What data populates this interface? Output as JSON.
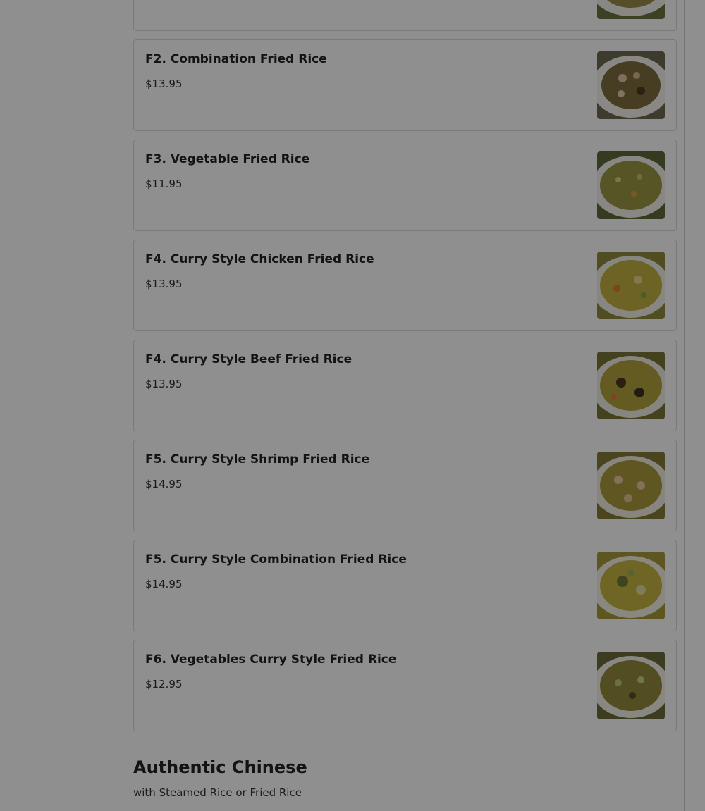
{
  "menu": {
    "items": [
      {
        "title": "",
        "price": "",
        "image": "fried-rice-photo"
      },
      {
        "title": "F2. Combination Fried Rice",
        "price": "$13.95",
        "image": "fried-rice-photo"
      },
      {
        "title": "F3. Vegetable Fried Rice",
        "price": "$11.95",
        "image": "fried-rice-photo"
      },
      {
        "title": "F4. Curry Style Chicken Fried Rice",
        "price": "$13.95",
        "image": "fried-rice-photo"
      },
      {
        "title": "F4. Curry Style Beef Fried Rice",
        "price": "$13.95",
        "image": "fried-rice-photo"
      },
      {
        "title": "F5. Curry Style Shrimp Fried Rice",
        "price": "$14.95",
        "image": "fried-rice-photo"
      },
      {
        "title": "F5. Curry Style Combination Fried Rice",
        "price": "$14.95",
        "image": "fried-rice-photo"
      },
      {
        "title": "F6. Vegetables Curry Style Fried Rice",
        "price": "$12.95",
        "image": "fried-rice-photo"
      }
    ]
  },
  "section": {
    "title": "Authentic Chinese",
    "subtitle": "with Steamed Rice or Fried Rice"
  },
  "colors": {
    "overlay": "#000000",
    "card_border": "#d9d9d9",
    "text": "#222222"
  }
}
